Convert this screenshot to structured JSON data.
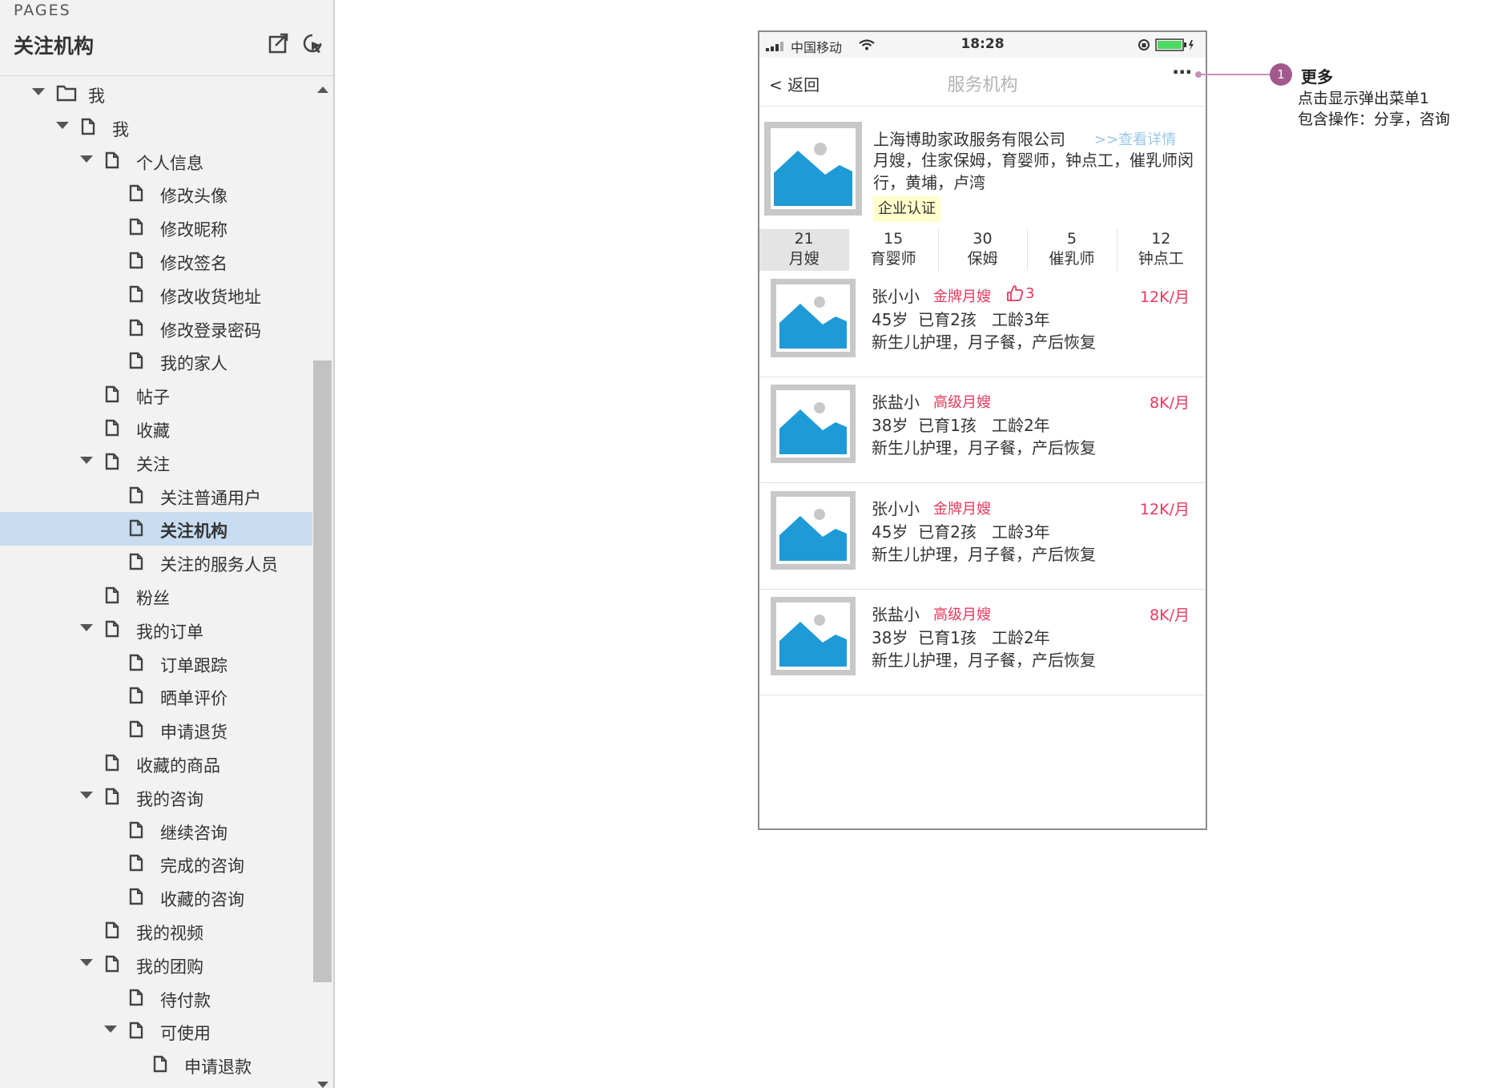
{
  "panel": {
    "pages_label": "PAGES",
    "title": "关注机构",
    "tree": [
      {
        "label": "我",
        "depth": 0,
        "kind": "folder",
        "expanded": true
      },
      {
        "label": "我",
        "depth": 1,
        "kind": "page",
        "expanded": true
      },
      {
        "label": "个人信息",
        "depth": 2,
        "kind": "page",
        "expanded": true
      },
      {
        "label": "修改头像",
        "depth": 3,
        "kind": "page"
      },
      {
        "label": "修改昵称",
        "depth": 3,
        "kind": "page"
      },
      {
        "label": "修改签名",
        "depth": 3,
        "kind": "page"
      },
      {
        "label": "修改收货地址",
        "depth": 3,
        "kind": "page"
      },
      {
        "label": "修改登录密码",
        "depth": 3,
        "kind": "page"
      },
      {
        "label": "我的家人",
        "depth": 3,
        "kind": "page"
      },
      {
        "label": "帖子",
        "depth": 2,
        "kind": "page"
      },
      {
        "label": "收藏",
        "depth": 2,
        "kind": "page"
      },
      {
        "label": "关注",
        "depth": 2,
        "kind": "page",
        "expanded": true
      },
      {
        "label": "关注普通用户",
        "depth": 3,
        "kind": "page"
      },
      {
        "label": "关注机构",
        "depth": 3,
        "kind": "page",
        "selected": true
      },
      {
        "label": "关注的服务人员",
        "depth": 3,
        "kind": "page"
      },
      {
        "label": "粉丝",
        "depth": 2,
        "kind": "page"
      },
      {
        "label": "我的订单",
        "depth": 2,
        "kind": "page",
        "expanded": true
      },
      {
        "label": "订单跟踪",
        "depth": 3,
        "kind": "page"
      },
      {
        "label": "晒单评价",
        "depth": 3,
        "kind": "page"
      },
      {
        "label": "申请退货",
        "depth": 3,
        "kind": "page"
      },
      {
        "label": "收藏的商品",
        "depth": 2,
        "kind": "page"
      },
      {
        "label": "我的咨询",
        "depth": 2,
        "kind": "page",
        "expanded": true
      },
      {
        "label": "继续咨询",
        "depth": 3,
        "kind": "page"
      },
      {
        "label": "完成的咨询",
        "depth": 3,
        "kind": "page"
      },
      {
        "label": "收藏的咨询",
        "depth": 3,
        "kind": "page"
      },
      {
        "label": "我的视频",
        "depth": 2,
        "kind": "page"
      },
      {
        "label": "我的团购",
        "depth": 2,
        "kind": "page",
        "expanded": true
      },
      {
        "label": "待付款",
        "depth": 3,
        "kind": "page"
      },
      {
        "label": "可使用",
        "depth": 3,
        "kind": "page",
        "expanded": true
      },
      {
        "label": "申请退款",
        "depth": 4,
        "kind": "page"
      }
    ]
  },
  "phone": {
    "status": {
      "carrier": "中国移动",
      "time": "18:28"
    },
    "nav": {
      "back": "< 返回",
      "title": "服务机构",
      "more": "···"
    },
    "org": {
      "name": "上海博助家政服务有限公司",
      "detail_link": ">>查看详情",
      "services": "月嫂，住家保姆，育婴师，钟点工，催乳师闵行，黄埔，卢湾",
      "badge": "企业认证"
    },
    "stats": [
      {
        "count": "21",
        "label": "月嫂",
        "active": true
      },
      {
        "count": "15",
        "label": "育婴师"
      },
      {
        "count": "30",
        "label": "保姆"
      },
      {
        "count": "5",
        "label": "催乳师"
      },
      {
        "count": "12",
        "label": "钟点工"
      }
    ],
    "workers": [
      {
        "name": "张小小",
        "level": "金牌月嫂",
        "likes": "3",
        "price": "12K/月",
        "info": "45岁  已育2孩   工龄3年",
        "skills": "新生儿护理，月子餐，产后恢复"
      },
      {
        "name": "张盐小",
        "level": "高级月嫂",
        "price": "8K/月",
        "info": "38岁  已育1孩   工龄2年",
        "skills": "新生儿护理，月子餐，产后恢复"
      },
      {
        "name": "张小小",
        "level": "金牌月嫂",
        "price": "12K/月",
        "info": "45岁  已育2孩   工龄3年",
        "skills": "新生儿护理，月子餐，产后恢复"
      },
      {
        "name": "张盐小",
        "level": "高级月嫂",
        "price": "8K/月",
        "info": "38岁  已育1孩   工龄2年",
        "skills": "新生儿护理，月子餐，产后恢复"
      }
    ]
  },
  "annotation": {
    "number": "1",
    "title": "更多",
    "line1": "点击显示弹出菜单1",
    "line2": "包含操作：分享，咨询"
  },
  "colors": {
    "accent_red": "#e8385d",
    "link_blue": "#9ac7e8",
    "selected_row": "#c8ddf1",
    "placeholder_blue": "#1e9ad6",
    "annotation_purple": "#a3598d"
  }
}
